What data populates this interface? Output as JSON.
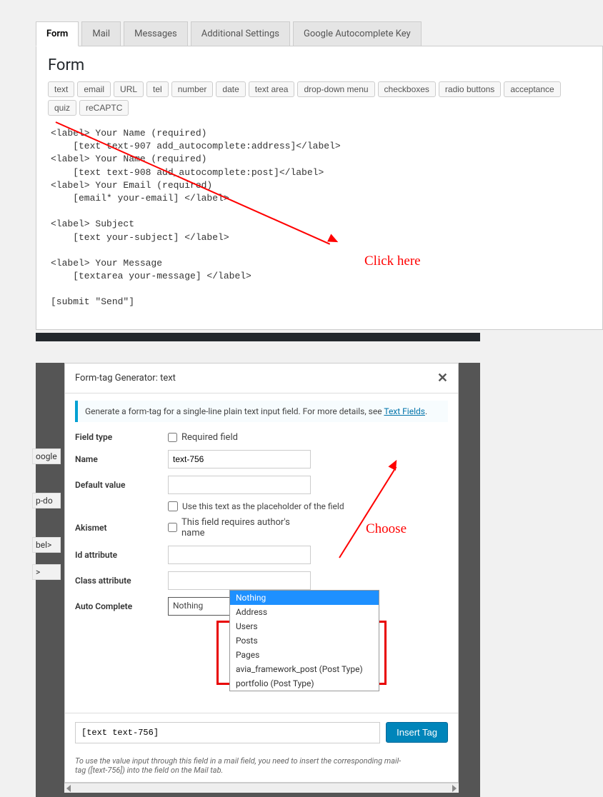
{
  "tabs": [
    {
      "label": "Form",
      "active": true
    },
    {
      "label": "Mail"
    },
    {
      "label": "Messages"
    },
    {
      "label": "Additional Settings"
    },
    {
      "label": "Google Autocomplete Key"
    }
  ],
  "form": {
    "title": "Form",
    "tagButtons": [
      "text",
      "email",
      "URL",
      "tel",
      "number",
      "date",
      "text area",
      "drop-down menu",
      "checkboxes",
      "radio buttons",
      "acceptance",
      "quiz",
      "reCAPTC"
    ],
    "content": "<label> Your Name (required)\n    [text text-907 add_autocomplete:address]</label>\n<label> Your Name (required)\n    [text text-908 add_autocomplete:post]</label>\n<label> Your Email (required)\n    [email* your-email] </label>\n\n<label> Subject\n    [text your-subject] </label>\n\n<label> Your Message\n    [textarea your-message] </label>\n\n[submit \"Send\"]"
  },
  "annot": {
    "clickHere": "Click here",
    "choose": "Choose"
  },
  "leftRemnants": [
    "oogle",
    "p-do",
    "bel>",
    ">"
  ],
  "modal": {
    "title": "Form-tag Generator: text",
    "infoText": "Generate a form-tag for a single-line plain text input field. For more details, see ",
    "infoLink": "Text Fields",
    "fields": {
      "fieldTypeLabel": "Field type",
      "requiredLabel": "Required field",
      "nameLabel": "Name",
      "nameValue": "text-756",
      "defaultLabel": "Default value",
      "defaultValue": "",
      "placeholderLabel": "Use this text as the placeholder of the field",
      "akismetLabel": "Akismet",
      "akismetCheckbox": "This field requires author's name",
      "idLabel": "Id attribute",
      "idValue": "",
      "classLabel": "Class attribute",
      "classValue": "",
      "autoCompleteLabel": "Auto Complete",
      "autoCompleteSelected": "Nothing"
    },
    "dropdownOptions": [
      {
        "label": "Nothing",
        "selected": true
      },
      {
        "label": "Address"
      },
      {
        "label": "Users"
      },
      {
        "label": "Posts"
      },
      {
        "label": "Pages"
      },
      {
        "label": "avia_framework_post (Post Type)"
      },
      {
        "label": "portfolio (Post Type)"
      }
    ],
    "generatedCode": "[text text-756]",
    "insertLabel": "Insert Tag",
    "footerNote1": "To use the value input through this field in a mail field, you need to insert the corresponding mail-",
    "footerNote2": "tag ([text-756]) into the field on the Mail tab."
  }
}
